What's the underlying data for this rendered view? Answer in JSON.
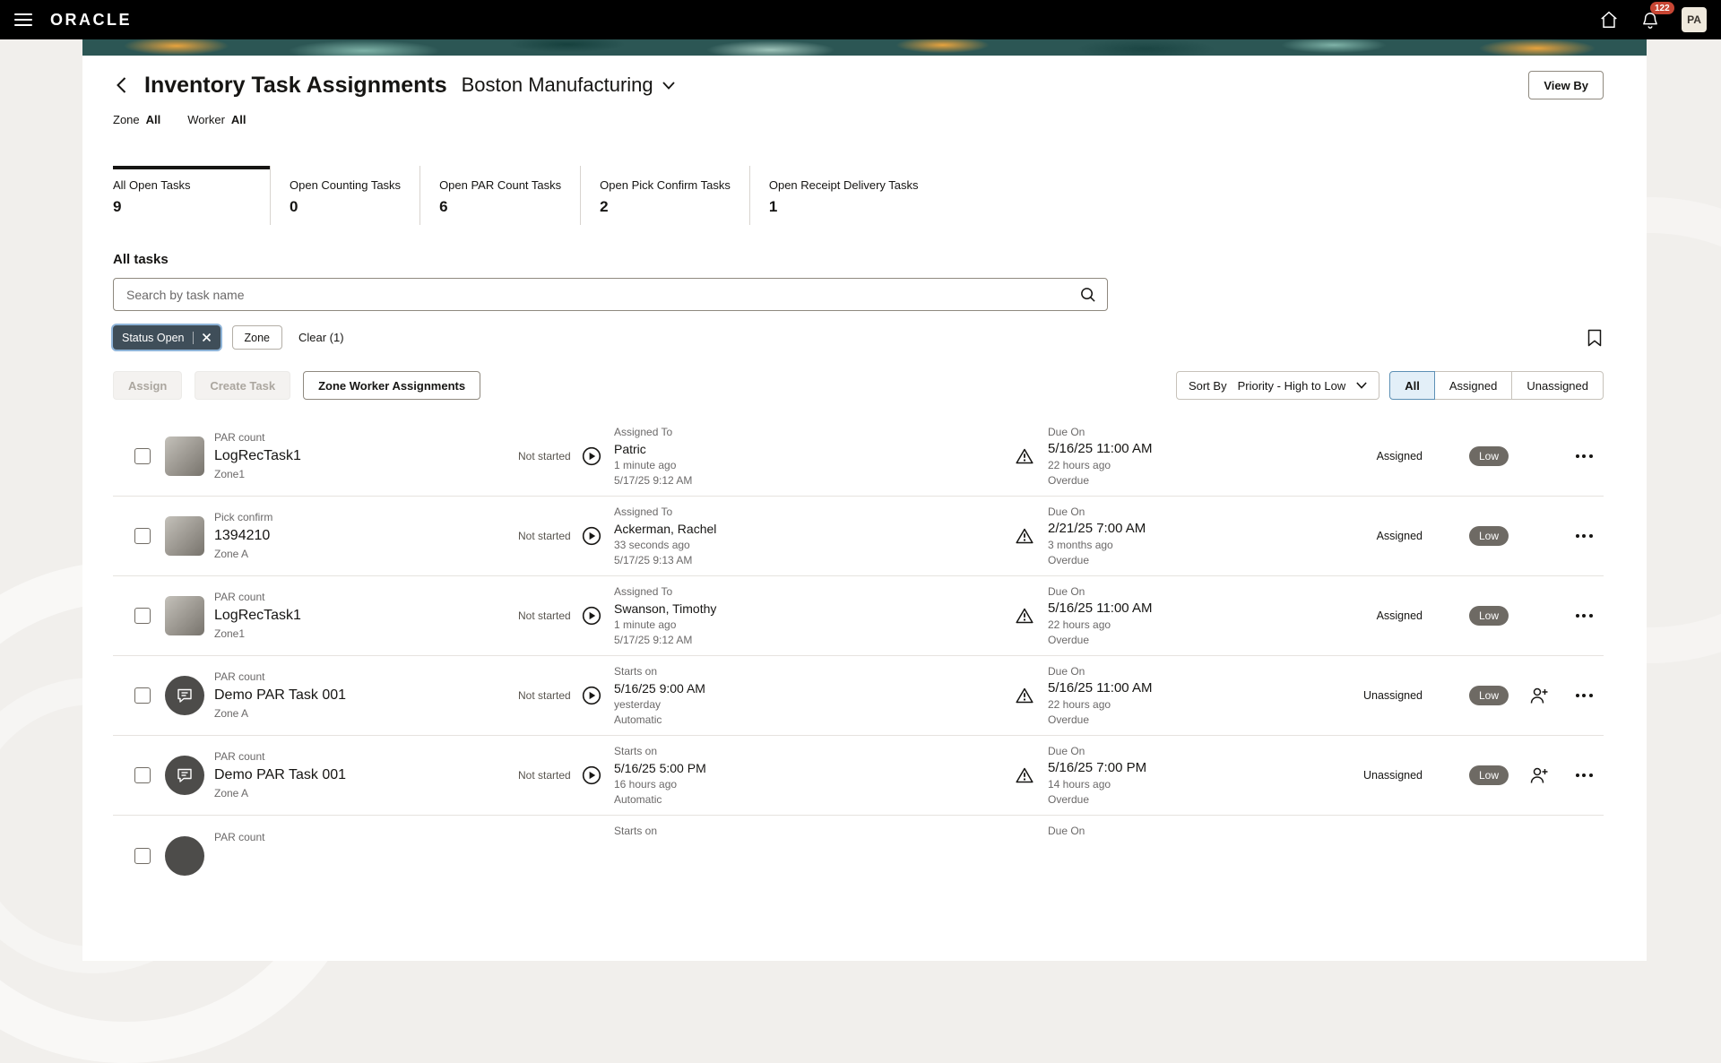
{
  "topbar": {
    "brand": "ORACLE",
    "notification_count": "122",
    "avatar_initials": "PA"
  },
  "header": {
    "title": "Inventory Task Assignments",
    "org": "Boston Manufacturing",
    "view_by": "View By",
    "zone_label": "Zone",
    "zone_value": "All",
    "worker_label": "Worker",
    "worker_value": "All"
  },
  "tabs": [
    {
      "label": "All Open Tasks",
      "count": "9"
    },
    {
      "label": "Open Counting Tasks",
      "count": "0"
    },
    {
      "label": "Open PAR Count Tasks",
      "count": "6"
    },
    {
      "label": "Open Pick Confirm Tasks",
      "count": "2"
    },
    {
      "label": "Open Receipt Delivery Tasks",
      "count": "1"
    }
  ],
  "list": {
    "section_title": "All tasks",
    "search_placeholder": "Search by task name",
    "status_chip": "Status Open",
    "zone_chip": "Zone",
    "clear": "Clear (1)",
    "assign": "Assign",
    "create_task": "Create Task",
    "zone_worker": "Zone Worker Assignments",
    "sort_label": "Sort By",
    "sort_value": "Priority - High to Low",
    "seg_all": "All",
    "seg_assigned": "Assigned",
    "seg_unassigned": "Unassigned"
  },
  "tasks": [
    {
      "type": "PAR count",
      "name": "LogRecTask1",
      "zone": "Zone1",
      "status": "Not started",
      "mid_label": "Assigned To",
      "mid_value": "Patric",
      "mid_rel": "1 minute ago",
      "mid_time": "5/17/25 9:12 AM",
      "due_label": "Due On",
      "due_value": "5/16/25 11:00 AM",
      "due_rel": "22 hours ago",
      "due_status": "Overdue",
      "assignment": "Assigned",
      "priority": "Low"
    },
    {
      "type": "Pick confirm",
      "name": "1394210",
      "zone": "Zone A",
      "status": "Not started",
      "mid_label": "Assigned To",
      "mid_value": "Ackerman, Rachel",
      "mid_rel": "33 seconds ago",
      "mid_time": "5/17/25 9:13 AM",
      "due_label": "Due On",
      "due_value": "2/21/25 7:00 AM",
      "due_rel": "3 months ago",
      "due_status": "Overdue",
      "assignment": "Assigned",
      "priority": "Low"
    },
    {
      "type": "PAR count",
      "name": "LogRecTask1",
      "zone": "Zone1",
      "status": "Not started",
      "mid_label": "Assigned To",
      "mid_value": "Swanson, Timothy",
      "mid_rel": "1 minute ago",
      "mid_time": "5/17/25 9:12 AM",
      "due_label": "Due On",
      "due_value": "5/16/25 11:00 AM",
      "due_rel": "22 hours ago",
      "due_status": "Overdue",
      "assignment": "Assigned",
      "priority": "Low"
    },
    {
      "type": "PAR count",
      "name": "Demo PAR Task 001",
      "zone": "Zone A",
      "status": "Not started",
      "mid_label": "Starts on",
      "mid_value": "5/16/25 9:00 AM",
      "mid_rel": "yesterday",
      "mid_time": "Automatic",
      "due_label": "Due On",
      "due_value": "5/16/25 11:00 AM",
      "due_rel": "22 hours ago",
      "due_status": "Overdue",
      "assignment": "Unassigned",
      "priority": "Low"
    },
    {
      "type": "PAR count",
      "name": "Demo PAR Task 001",
      "zone": "Zone A",
      "status": "Not started",
      "mid_label": "Starts on",
      "mid_value": "5/16/25 5:00 PM",
      "mid_rel": "16 hours ago",
      "mid_time": "Automatic",
      "due_label": "Due On",
      "due_value": "5/16/25 7:00 PM",
      "due_rel": "14 hours ago",
      "due_status": "Overdue",
      "assignment": "Unassigned",
      "priority": "Low"
    },
    {
      "type": "PAR count",
      "name": "",
      "zone": "",
      "status": "",
      "mid_label": "Starts on",
      "mid_value": "",
      "mid_rel": "",
      "mid_time": "",
      "due_label": "Due On",
      "due_value": "",
      "due_rel": "",
      "due_status": "",
      "assignment": "",
      "priority": ""
    }
  ],
  "colors": {
    "topbar": "#000000",
    "banner_teal": "#2c5654",
    "chip_dark": "#3f4e59",
    "badge_low": "#6e6a64",
    "notification_red": "#c74634",
    "segment_selected_bg": "#e3eff8",
    "page_bg": "#f1efec"
  }
}
